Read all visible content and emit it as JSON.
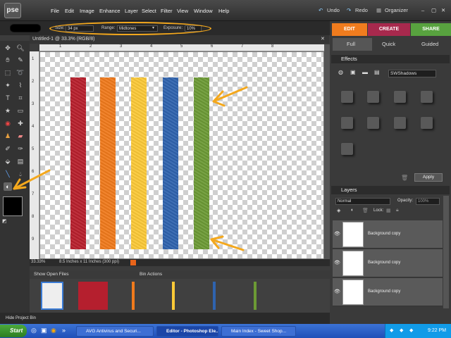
{
  "app": {
    "logo": "pse"
  },
  "menu": [
    "File",
    "Edit",
    "Image",
    "Enhance",
    "Layer",
    "Select",
    "Filter",
    "View",
    "Window",
    "Help"
  ],
  "toolbar_right": {
    "undo": "Undo",
    "redo": "Redo",
    "organizer": "Organizer"
  },
  "options": {
    "size_label": "Size:",
    "size_value": "34 px",
    "range_label": "Range:",
    "range_value": "Midtones",
    "exposure_label": "Exposure:",
    "exposure_value": "10%"
  },
  "document": {
    "tab": "Untitled-1 @ 33.3% (RGB/8)",
    "zoom": "33.33%",
    "doc_size": "8.5 Inches x 11 Inches (300 ppi)"
  },
  "ruler_h": [
    "1",
    "2",
    "3",
    "4",
    "5",
    "6",
    "7",
    "8"
  ],
  "ruler_v": [
    "1",
    "2",
    "3",
    "4",
    "5",
    "6",
    "7",
    "8",
    "9"
  ],
  "stripes": [
    {
      "color": "#b8202d"
    },
    {
      "color": "#f07a1c"
    },
    {
      "color": "#fbc937"
    },
    {
      "color": "#2f63ae"
    },
    {
      "color": "#6c9a35"
    }
  ],
  "bin": {
    "show_label": "Show Open Files",
    "actions_label": "Bin Actions",
    "hide_label": "Hide Project Bin"
  },
  "modes": {
    "edit": "EDIT",
    "create": "CREATE",
    "share": "SHARE"
  },
  "submodes": {
    "full": "Full",
    "quick": "Quick",
    "guided": "Guided"
  },
  "effects": {
    "title": "Effects",
    "filter": "SWShadows",
    "apply": "Apply"
  },
  "layers": {
    "title": "Layers",
    "blend": "Normal",
    "opacity_label": "Opacity:",
    "opacity_value": "100%",
    "lock_label": "Lock:",
    "rows": [
      "Background copy",
      "Background copy",
      "Background copy"
    ]
  },
  "taskbar": {
    "start": "Start",
    "tasks": [
      "AVG Antivirus and Securi...",
      "Editor - Photoshop Ele...",
      "Main Index - Sweet Shop..."
    ],
    "clock": "9:22 PM"
  },
  "colors": {
    "accent_edit": "#f07c1e",
    "accent_create": "#a7294d",
    "accent_share": "#58a23f",
    "annotation": "#f4a81d"
  }
}
